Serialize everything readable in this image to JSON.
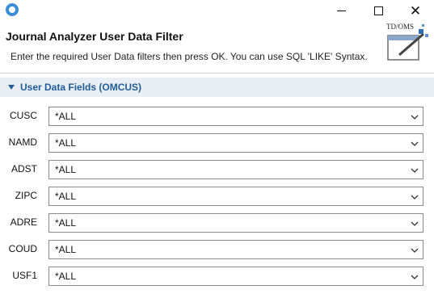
{
  "window": {
    "title": "Journal Analyzer User Data Filter",
    "controls": {
      "minimize": "minimize",
      "maximize": "maximize",
      "close": "✕"
    }
  },
  "header": {
    "title": "Journal Analyzer User Data Filter",
    "instruction": "Enter the required User Data filters then press OK. You can use SQL 'LIKE' Syntax.",
    "logo_text": "TD/OMS"
  },
  "section": {
    "title": "User Data Fields (OMCUS)",
    "expanded": true
  },
  "fields": [
    {
      "label": "CUSC",
      "value": "*ALL"
    },
    {
      "label": "NAMD",
      "value": "*ALL"
    },
    {
      "label": "ADST",
      "value": "*ALL"
    },
    {
      "label": "ZIPC",
      "value": "*ALL"
    },
    {
      "label": "ADRE",
      "value": "*ALL"
    },
    {
      "label": "COUD",
      "value": "*ALL"
    },
    {
      "label": "USF1",
      "value": "*ALL"
    }
  ],
  "colors": {
    "accent": "#1f5d99",
    "section_bg": "#e9eef4",
    "app_icon": "#3a8ed6"
  }
}
